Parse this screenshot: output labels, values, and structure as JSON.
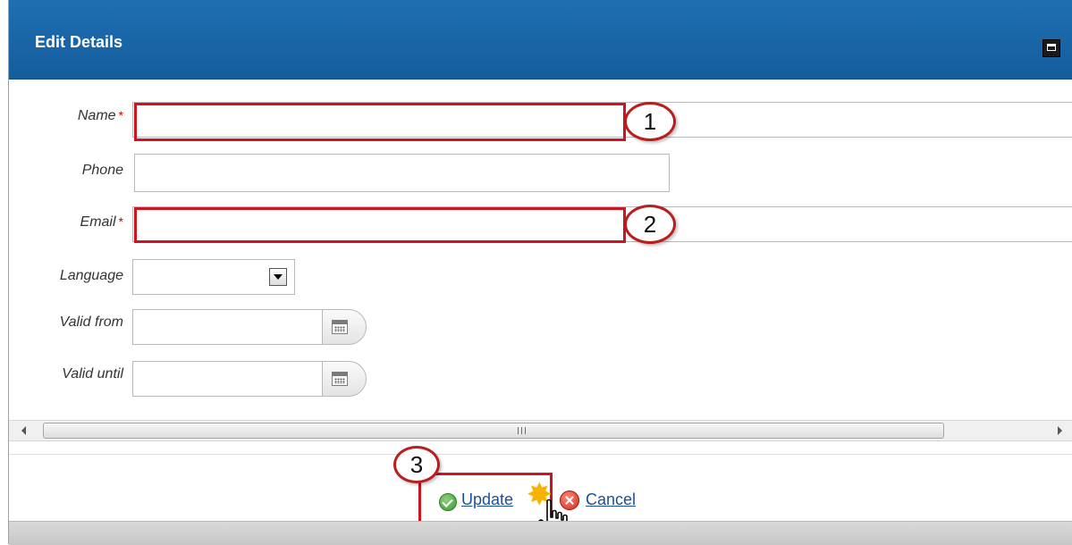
{
  "dialog": {
    "title": "Edit Details"
  },
  "form": {
    "name_label": "Name",
    "phone_label": "Phone",
    "email_label": "Email",
    "language_label": "Language",
    "valid_from_label": "Valid from",
    "valid_until_label": "Valid until",
    "required_marker": "*",
    "values": {
      "name": "",
      "phone": "",
      "email": "",
      "language": "",
      "valid_from": "",
      "valid_until": ""
    }
  },
  "annotations": {
    "callout_1": "1",
    "callout_2": "2",
    "callout_3": "3"
  },
  "scrollbar": {
    "grip": "III"
  },
  "actions": {
    "update_label": "Update",
    "cancel_label": "Cancel"
  },
  "colors": {
    "titlebar": "#145d9c",
    "highlight": "#cc1520",
    "link": "#1a4f9c"
  },
  "icons": [
    "maximize-icon",
    "chevron-down-icon",
    "calendar-icon",
    "check-circle-icon",
    "cancel-icon",
    "hand-pointer-icon"
  ]
}
